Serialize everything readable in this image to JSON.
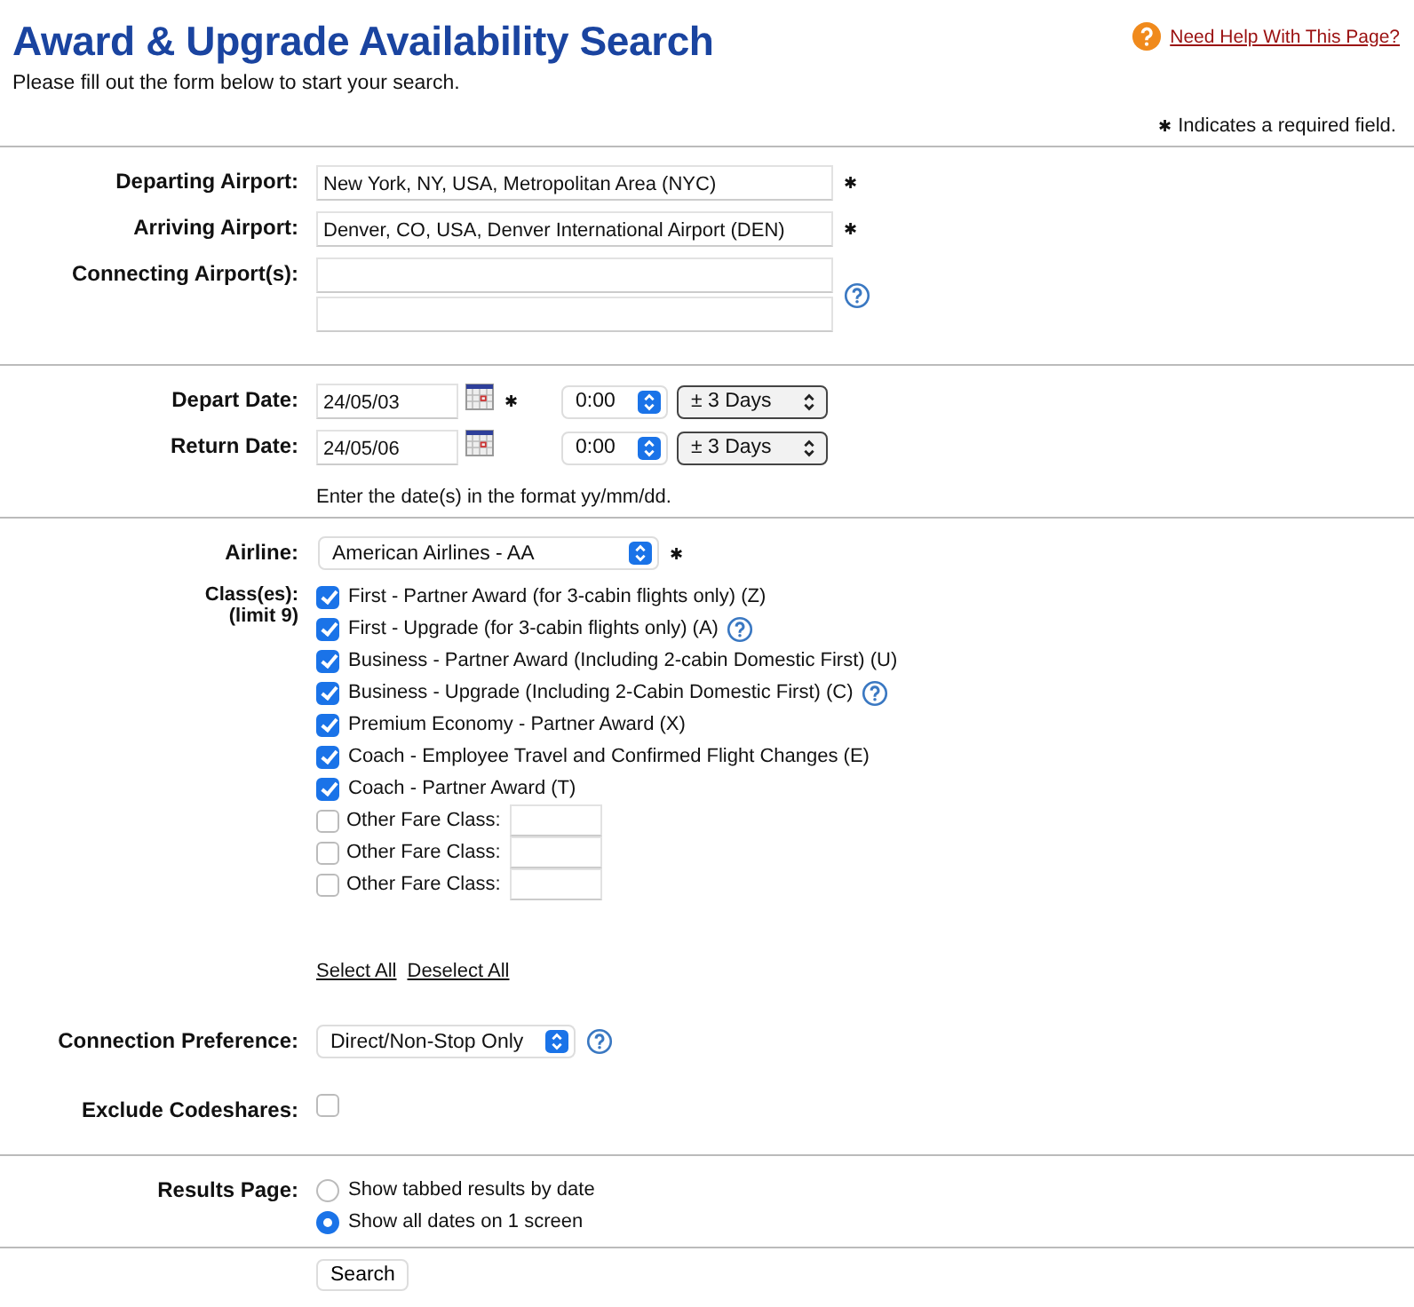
{
  "header": {
    "title": "Award & Upgrade Availability Search",
    "help_link": "Need Help With This Page?",
    "intro": "Please fill out the form below to start your search.",
    "required_note_mark": "✱",
    "required_note": "Indicates a required field."
  },
  "airports": [
    {
      "label": "Departing Airport:",
      "kind": "single",
      "value": "New York, NY, USA, Metropolitan Area (NYC)",
      "required_mark": "✱"
    },
    {
      "label": "Arriving Airport:",
      "kind": "single",
      "value": "Denver, CO, USA, Denver International Airport (DEN)",
      "required_mark": "✱"
    },
    {
      "label": "Connecting Airport(s):",
      "kind": "double",
      "help": true
    }
  ],
  "dates": [
    {
      "label": "Depart Date:",
      "value": "24/05/03",
      "required_mark": "✱",
      "time": "0:00",
      "range": "± 3 Days"
    },
    {
      "label": "Return Date:",
      "value": "24/05/06",
      "time": "0:00",
      "range": "± 3 Days"
    }
  ],
  "date_hint": "Enter the date(s) in the format yy/mm/dd.",
  "airline": {
    "label": "Airline:",
    "value": "American Airlines - AA",
    "required_mark": "✱"
  },
  "classes": {
    "label": "Class(es):",
    "sublabel": "(limit 9)",
    "options": [
      {
        "kind": "fixed",
        "label": "First - Partner Award (for 3-cabin flights only) (Z)",
        "checked": true,
        "help": false
      },
      {
        "kind": "fixed",
        "label": "First - Upgrade (for 3-cabin flights only) (A)",
        "checked": true,
        "help": true
      },
      {
        "kind": "fixed",
        "label": "Business - Partner Award (Including 2-cabin Domestic First) (U)",
        "checked": true,
        "help": false
      },
      {
        "kind": "fixed",
        "label": "Business - Upgrade (Including 2-Cabin Domestic First) (C)",
        "checked": true,
        "help": true
      },
      {
        "kind": "fixed",
        "label": "Premium Economy - Partner Award (X)",
        "checked": true,
        "help": false
      },
      {
        "kind": "fixed",
        "label": "Coach - Employee Travel and Confirmed Flight Changes (E)",
        "checked": true,
        "help": false
      },
      {
        "kind": "fixed",
        "label": "Coach - Partner Award (T)",
        "checked": true,
        "help": false
      },
      {
        "kind": "other",
        "label": "Other Fare Class:",
        "checked": false
      },
      {
        "kind": "other",
        "label": "Other Fare Class:",
        "checked": false
      },
      {
        "kind": "other",
        "label": "Other Fare Class:",
        "checked": false
      }
    ]
  },
  "links": [
    "Select All",
    "Deselect All"
  ],
  "connection": {
    "label": "Connection Preference:",
    "value": "Direct/Non-Stop Only",
    "help": true
  },
  "codeshares": {
    "label": "Exclude Codeshares:",
    "checked": false
  },
  "results": {
    "label": "Results Page:",
    "options": [
      {
        "label": "Show tabbed results by date",
        "selected": false
      },
      {
        "label": "Show all dates on 1 screen",
        "selected": true
      }
    ]
  },
  "search_button": "Search"
}
